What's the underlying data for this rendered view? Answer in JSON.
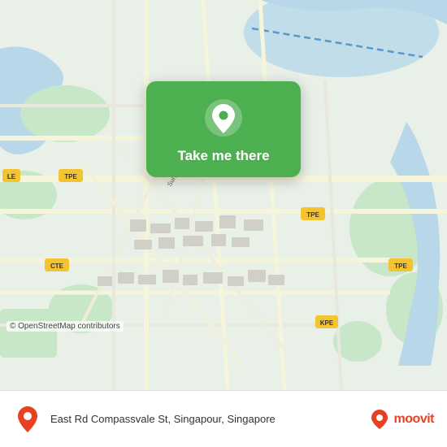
{
  "map": {
    "copyright": "© OpenStreetMap contributors"
  },
  "card": {
    "label": "Take me there",
    "icon_name": "location-pin-icon"
  },
  "bottom_bar": {
    "address": "East Rd Compassvale St, Singapour, Singapore",
    "logo_text": "moovit"
  }
}
